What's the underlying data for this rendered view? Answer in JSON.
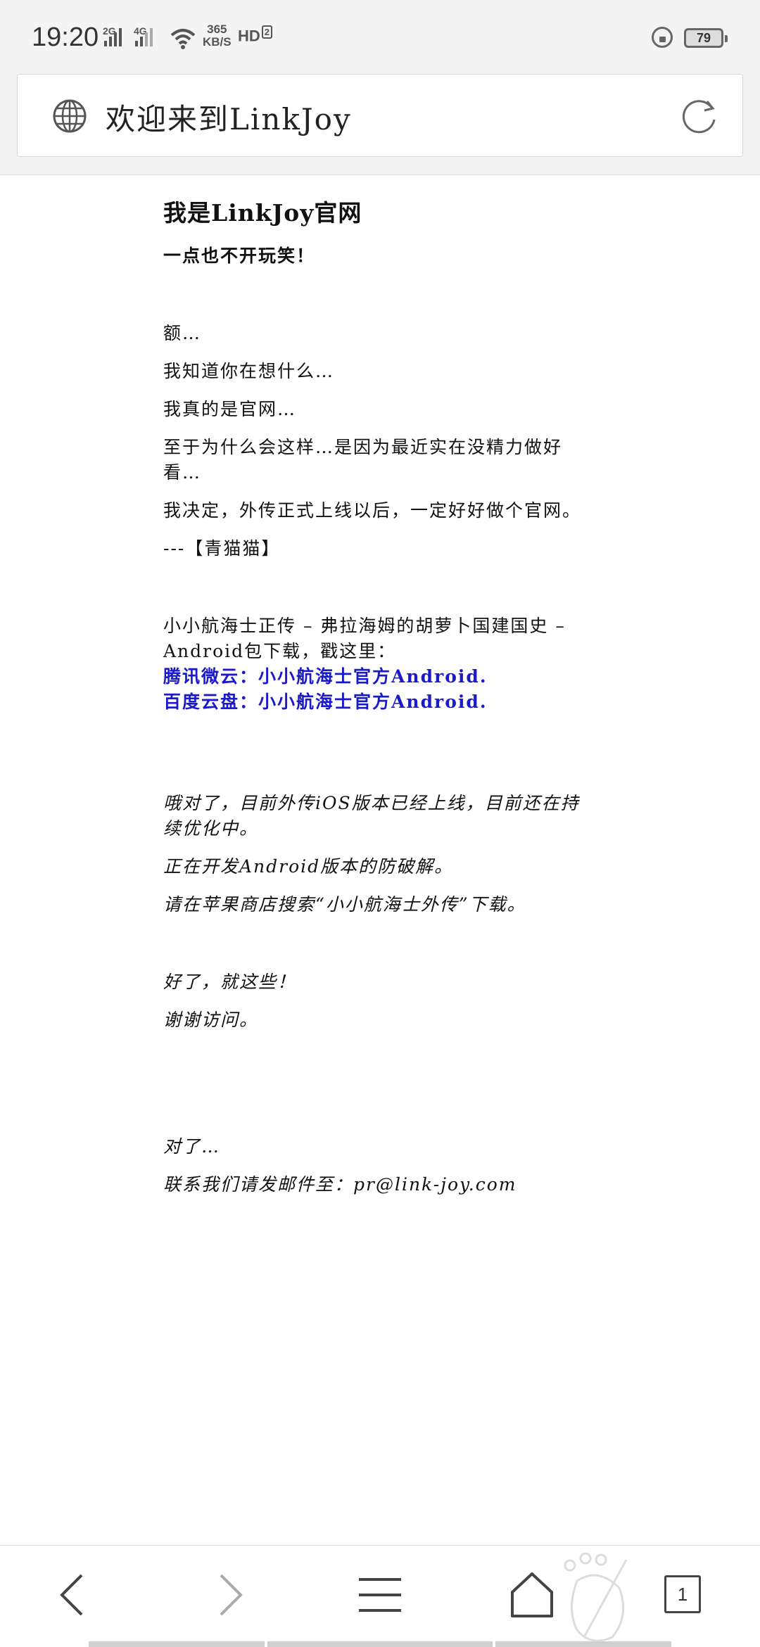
{
  "status_bar": {
    "time": "19:20",
    "network_1": "2G",
    "network_2": "4G",
    "speed_value": "365",
    "speed_unit": "KB/S",
    "hd_label": "HD",
    "hd_index": "2",
    "battery": "79"
  },
  "address_bar": {
    "title": "欢迎来到LinkJoy",
    "globe_icon": "globe-icon",
    "reload_icon": "reload-icon"
  },
  "page": {
    "heading": "我是LinkJoy官网",
    "line_1": "一点也不开玩笑！",
    "line_2": "额…",
    "line_3": "我知道你在想什么…",
    "line_4": "我真的是官网…",
    "line_5a": "至于为什么会这样…是因为最近实在没精力做好",
    "line_5b": "看…",
    "line_6": "我决定，外传正式上线以后，一定好好做个官网。",
    "line_7": "---【青猫猫】",
    "line_8a": "小小航海士正传 – 弗拉海姆的胡萝卜国建国史 –",
    "line_8b": "Android包下载，戳这里：",
    "link_1": "腾讯微云：小小航海士官方Android.",
    "link_2": "百度云盘：小小航海士官方Android.",
    "line_9a": "哦对了，目前外传iOS版本已经上线，目前还在持",
    "line_9b": "续优化中。",
    "line_10": "正在开发Android版本的防破解。",
    "line_11": "请在苹果商店搜索“小小航海士外传”下载。",
    "line_12": "好了，就这些！",
    "line_13": "谢谢访问。",
    "line_14": "对了…",
    "line_15": "联系我们请发邮件至：pr@link-joy.com"
  },
  "bottom_nav": {
    "tab_count": "1",
    "icons": [
      "back-icon",
      "forward-icon",
      "menu-icon",
      "home-icon",
      "tabs-icon"
    ]
  },
  "colors": {
    "link": "#1a1acc",
    "bar_background": "#f4f4f4"
  }
}
